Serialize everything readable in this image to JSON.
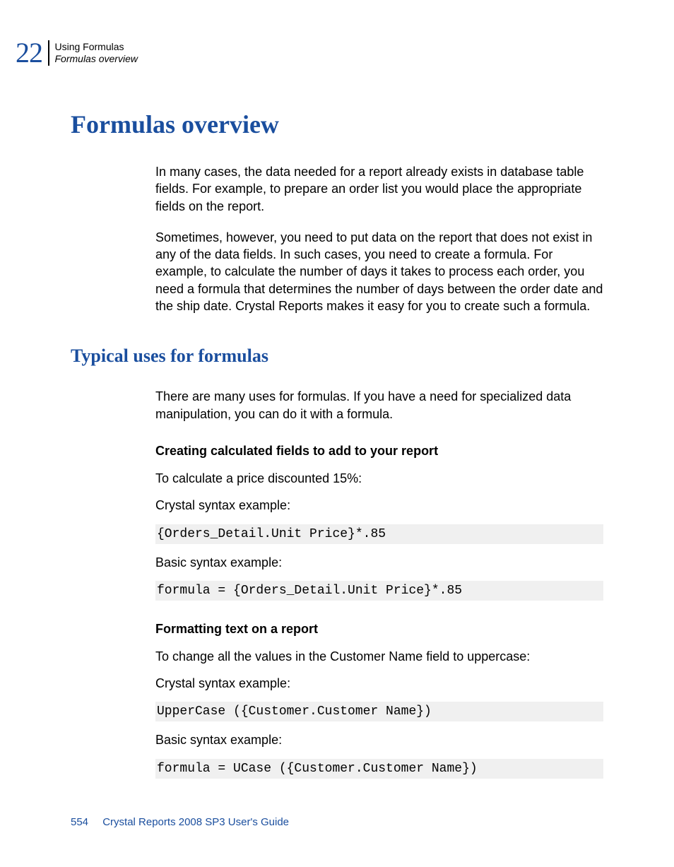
{
  "header": {
    "chapter_number": "22",
    "line1": "Using Formulas",
    "line2": "Formulas overview"
  },
  "title": "Formulas overview",
  "para1": "In many cases, the data needed for a report already exists in database table fields. For example, to prepare an order list you would place the appropriate fields on the report.",
  "para2": "Sometimes, however, you need to put data on the report that does not exist in any of the data fields. In such cases, you need to create a formula. For example, to calculate the number of days it takes to process each order, you need a formula that determines the number of days between the order date and the ship date. Crystal Reports makes it easy for you to create such a formula.",
  "subsection_title": "Typical uses for formulas",
  "para3": "There are many uses for formulas. If you have a need for specialized data manipulation, you can do it with a formula.",
  "block1": {
    "heading": "Creating calculated fields to add to your report",
    "intro": "To calculate a price discounted 15%:",
    "label_crystal": "Crystal syntax example:",
    "code_crystal": "{Orders_Detail.Unit Price}*.85",
    "label_basic": "Basic syntax example:",
    "code_basic": "formula = {Orders_Detail.Unit Price}*.85"
  },
  "block2": {
    "heading": "Formatting text on a report",
    "intro": "To change all the values in the Customer Name field to uppercase:",
    "label_crystal": "Crystal syntax example:",
    "code_crystal": "UpperCase ({Customer.Customer Name})",
    "label_basic": "Basic syntax example:",
    "code_basic": "formula = UCase ({Customer.Customer Name})"
  },
  "footer": {
    "page": "554",
    "doc": "Crystal Reports 2008 SP3 User's Guide"
  }
}
